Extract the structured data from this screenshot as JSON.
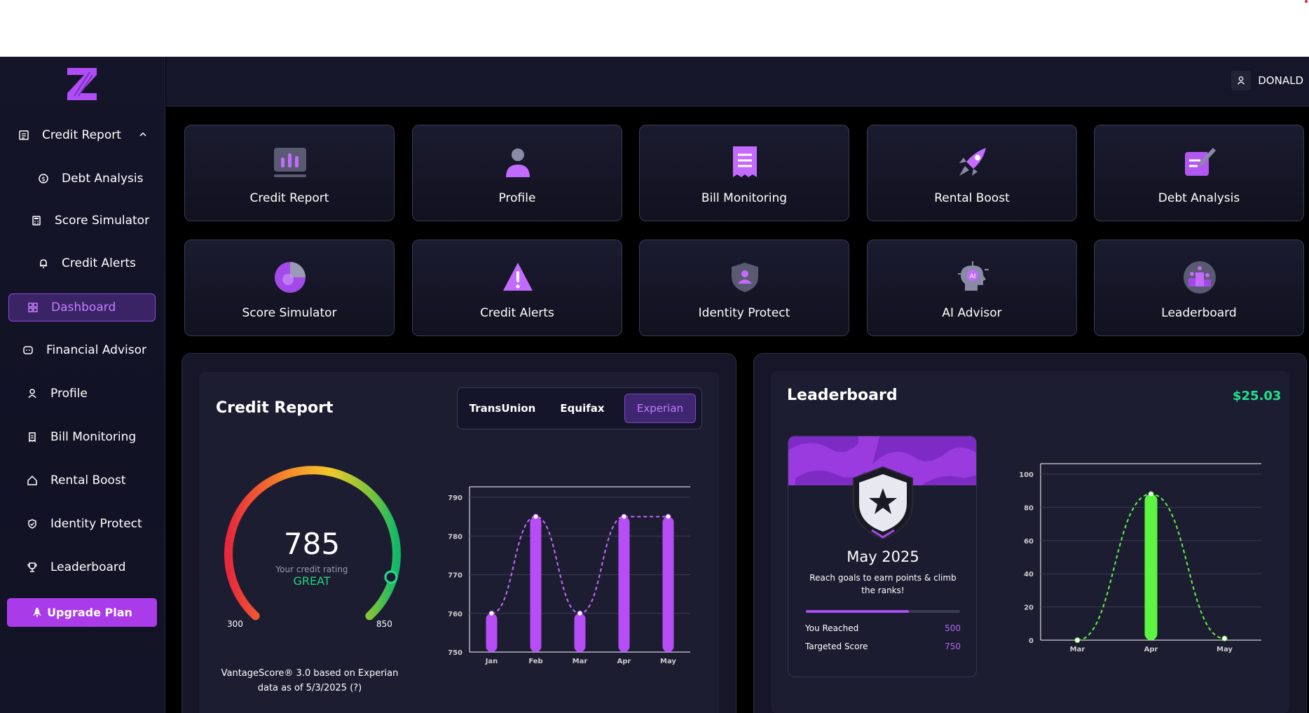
{
  "user": {
    "name": "DONALD"
  },
  "sidebar": {
    "items": [
      {
        "label": "Credit Report",
        "icon": "report-icon"
      },
      {
        "label": "Debt Analysis",
        "icon": "dollar-circle-icon"
      },
      {
        "label": "Score Simulator",
        "icon": "calculator-icon"
      },
      {
        "label": "Credit Alerts",
        "icon": "bell-icon"
      },
      {
        "label": "Dashboard",
        "icon": "grid-icon"
      },
      {
        "label": "Financial Advisor",
        "icon": "chat-icon"
      },
      {
        "label": "Profile",
        "icon": "person-icon"
      },
      {
        "label": "Bill Monitoring",
        "icon": "bill-icon"
      },
      {
        "label": "Rental Boost",
        "icon": "home-icon"
      },
      {
        "label": "Identity Protect",
        "icon": "shield-icon"
      },
      {
        "label": "Leaderboard",
        "icon": "trophy-icon"
      }
    ],
    "upgrade_label": "Upgrade Plan"
  },
  "tiles": [
    {
      "label": "Credit Report"
    },
    {
      "label": "Profile"
    },
    {
      "label": "Bill Monitoring"
    },
    {
      "label": "Rental Boost"
    },
    {
      "label": "Debt Analysis"
    },
    {
      "label": "Score Simulator"
    },
    {
      "label": "Credit Alerts"
    },
    {
      "label": "Identity Protect"
    },
    {
      "label": "AI Advisor"
    },
    {
      "label": "Leaderboard"
    }
  ],
  "credit_report": {
    "title": "Credit Report",
    "tabs": [
      "TransUnion",
      "Equifax",
      "Experian"
    ],
    "active_tab": "Experian",
    "score": "785",
    "score_caption": "Your credit rating",
    "rating": "GREAT",
    "min": "300",
    "max": "850",
    "note": "VantageScore® 3.0 based on Experian data as of 5/3/2025 (?)"
  },
  "leaderboard": {
    "title": "Leaderboard",
    "amount": "$25.03",
    "month": "May 2025",
    "description": "Reach goals to earn points & climb the ranks!",
    "progress": 0.667,
    "reached_label": "You Reached",
    "reached_value": "500",
    "target_label": "Targeted Score",
    "target_value": "750"
  },
  "colors": {
    "accent": "#a93ce8",
    "bar": "#b64df5",
    "green": "#22e08a",
    "leader_bar": "#5cf542"
  },
  "chart_data": [
    {
      "type": "bar",
      "categories": [
        "Jan",
        "Feb",
        "Mar",
        "Apr",
        "May"
      ],
      "values": [
        760,
        785,
        760,
        785,
        785
      ],
      "ylim": [
        750,
        790
      ],
      "yticks": [
        750,
        760,
        770,
        780,
        790
      ],
      "grid": true
    },
    {
      "type": "bar",
      "categories": [
        "Mar",
        "Apr",
        "May"
      ],
      "values": [
        0,
        88,
        1
      ],
      "ylim": [
        0,
        100
      ],
      "yticks": [
        0,
        20,
        40,
        60,
        80,
        100
      ],
      "grid": true
    }
  ]
}
